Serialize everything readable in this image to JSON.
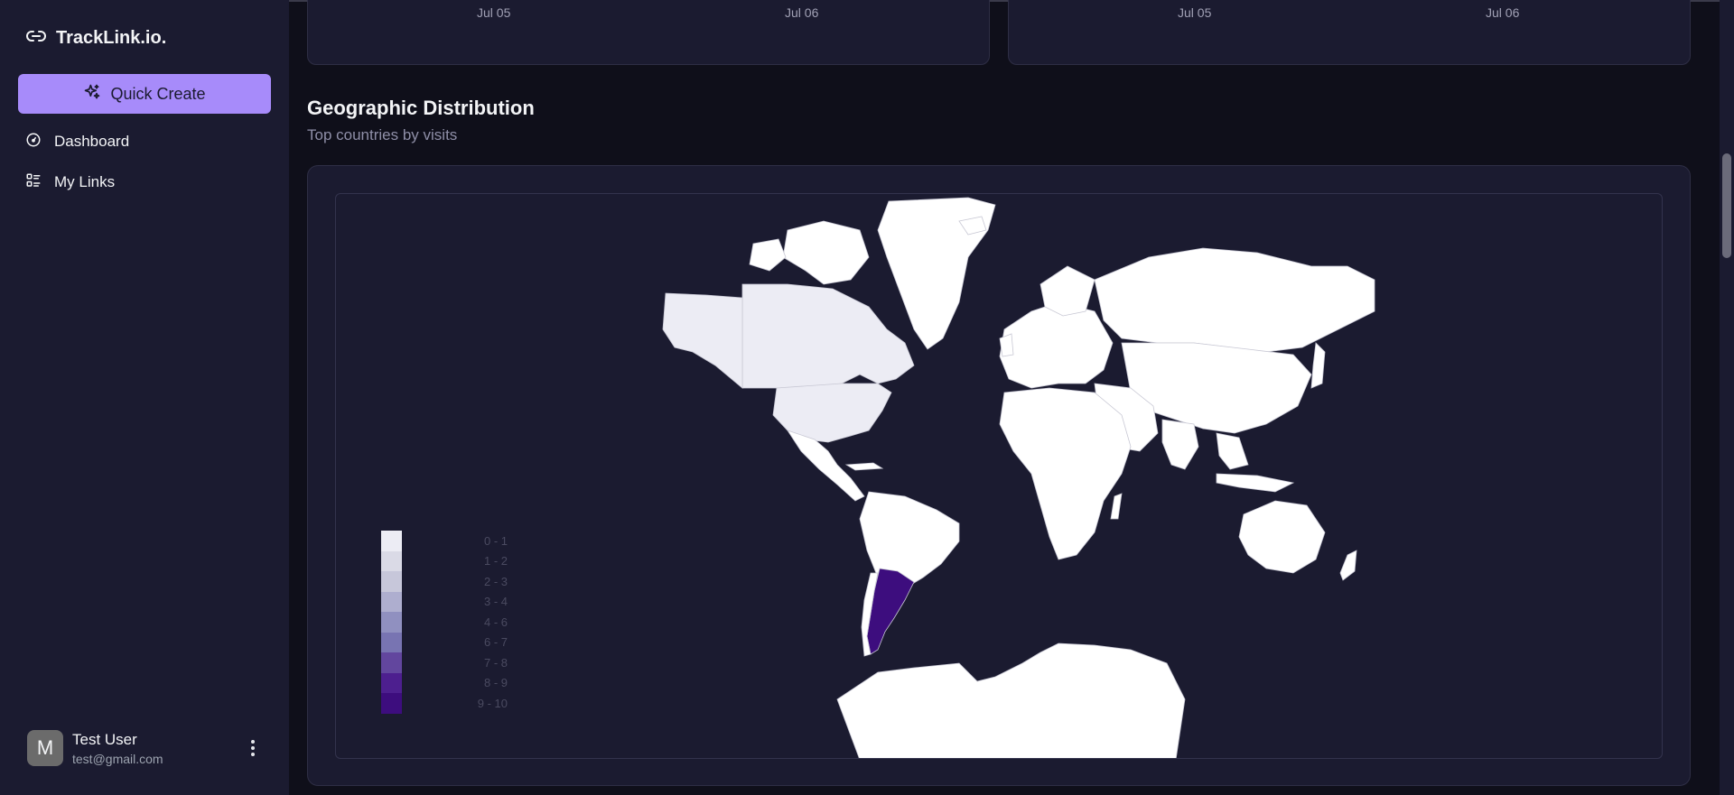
{
  "sidebar": {
    "brand": "TrackLink.io.",
    "quick_create": "Quick Create",
    "nav": [
      {
        "label": "Dashboard",
        "icon": "gauge-icon"
      },
      {
        "label": "My Links",
        "icon": "list-icon"
      }
    ],
    "user": {
      "avatar_letter": "M",
      "name": "Test User",
      "email": "test@gmail.com"
    }
  },
  "top_charts": [
    {
      "ticks": [
        "Jul 05",
        "Jul 06"
      ]
    },
    {
      "ticks": [
        "Jul 05",
        "Jul 06"
      ]
    }
  ],
  "geo": {
    "title": "Geographic Distribution",
    "subtitle": "Top countries by visits"
  },
  "chart_data": {
    "type": "heatmap",
    "subtype": "choropleth-world-map",
    "highlighted": [
      {
        "country": "Argentina",
        "bucket": "9 - 10"
      },
      {
        "country": "Canada",
        "bucket": "0 - 1"
      },
      {
        "country": "United States",
        "bucket": "0 - 1"
      }
    ],
    "legend": {
      "labels": [
        "0 - 1",
        "1 - 2",
        "2 - 3",
        "3 - 4",
        "4 - 6",
        "6 - 7",
        "7 - 8",
        "8 - 9",
        "9 - 10"
      ],
      "colors": [
        "#ececf4",
        "#dadae6",
        "#c7c7da",
        "#aeaecf",
        "#9090c0",
        "#7874b2",
        "#62469e",
        "#4d1f8f",
        "#3d0d7e"
      ]
    },
    "base_color": "#ffffff",
    "legend_position": "bottom-left"
  },
  "colors": {
    "accent": "#a78bfa",
    "sidebar_bg": "#1b1b30",
    "page_bg": "#0f0f1a"
  }
}
